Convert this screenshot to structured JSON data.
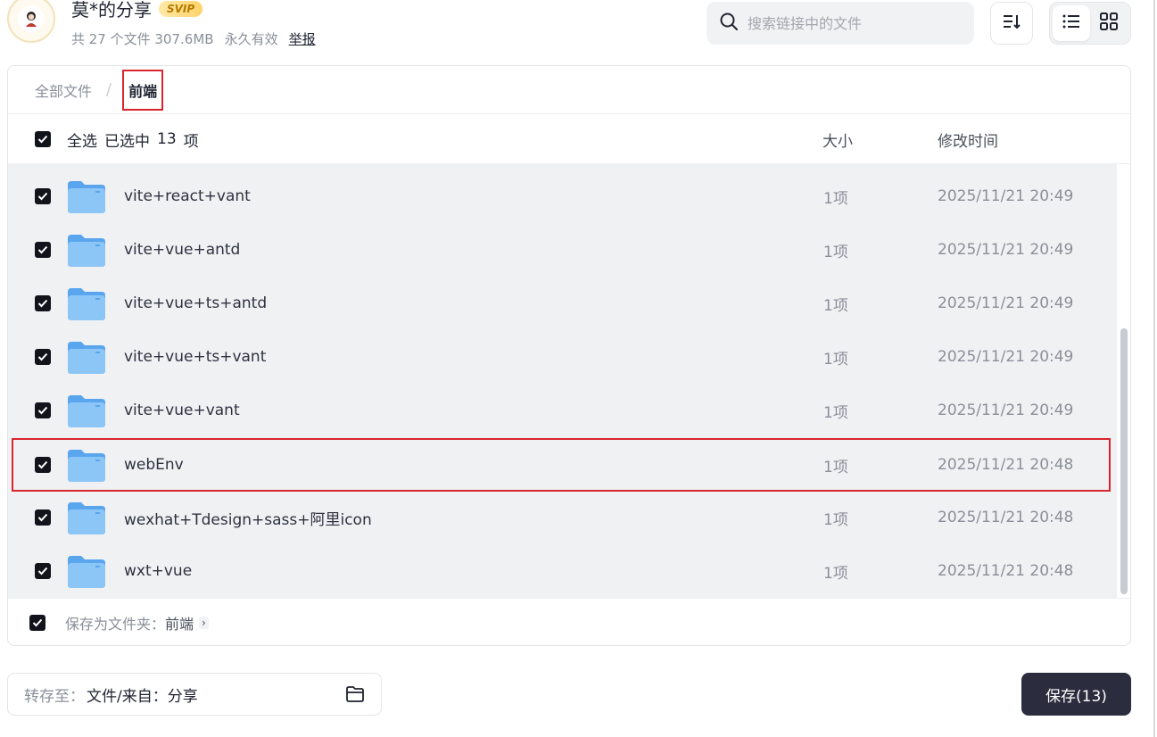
{
  "header": {
    "title": "莫*的分享",
    "badge": "SVIP",
    "file_count": "共 27 个文件 307.6MB",
    "validity": "永久有效",
    "report": "举报"
  },
  "search": {
    "placeholder": "搜索链接中的文件"
  },
  "breadcrumb": {
    "root": "全部文件",
    "separator": "/",
    "current": "前端"
  },
  "list_header": {
    "select_all": "全选",
    "selected_prefix": "已选中",
    "selected_count": "13",
    "selected_suffix": "项",
    "col_size": "大小",
    "col_time": "修改时间"
  },
  "rows": [
    {
      "name": "vite+react+vant",
      "size": "1项",
      "time": "2025/11/21 20:49",
      "checked": true
    },
    {
      "name": "vite+vue+antd",
      "size": "1项",
      "time": "2025/11/21 20:49",
      "checked": true
    },
    {
      "name": "vite+vue+ts+antd",
      "size": "1项",
      "time": "2025/11/21 20:49",
      "checked": true
    },
    {
      "name": "vite+vue+ts+vant",
      "size": "1项",
      "time": "2025/11/21 20:49",
      "checked": true
    },
    {
      "name": "vite+vue+vant",
      "size": "1项",
      "time": "2025/11/21 20:49",
      "checked": true
    },
    {
      "name": "webEnv",
      "size": "1项",
      "time": "2025/11/21 20:48",
      "checked": true
    },
    {
      "name": "wexhat+Tdesign+sass+阿里icon",
      "size": "1项",
      "time": "2025/11/21 20:48",
      "checked": true
    },
    {
      "name": "wxt+vue",
      "size": "1项",
      "time": "2025/11/21 20:48",
      "checked": true
    }
  ],
  "save_as_folder": {
    "label": "保存为文件夹：",
    "target": "前端",
    "chevron": "›"
  },
  "destination": {
    "label": "转存至：",
    "value": "文件/来自：分享"
  },
  "save_button": {
    "label": "保存(13)"
  },
  "colors": {
    "accent": "#2b2d3e",
    "checkbox": "#12141c",
    "highlight_border": "#d8262f",
    "folder": "#6fb3f2",
    "row_bg": "#f0f1f3"
  },
  "icons": [
    "search-icon",
    "sort-icon",
    "list-view-icon",
    "grid-view-icon",
    "folder-icon",
    "check-icon"
  ]
}
